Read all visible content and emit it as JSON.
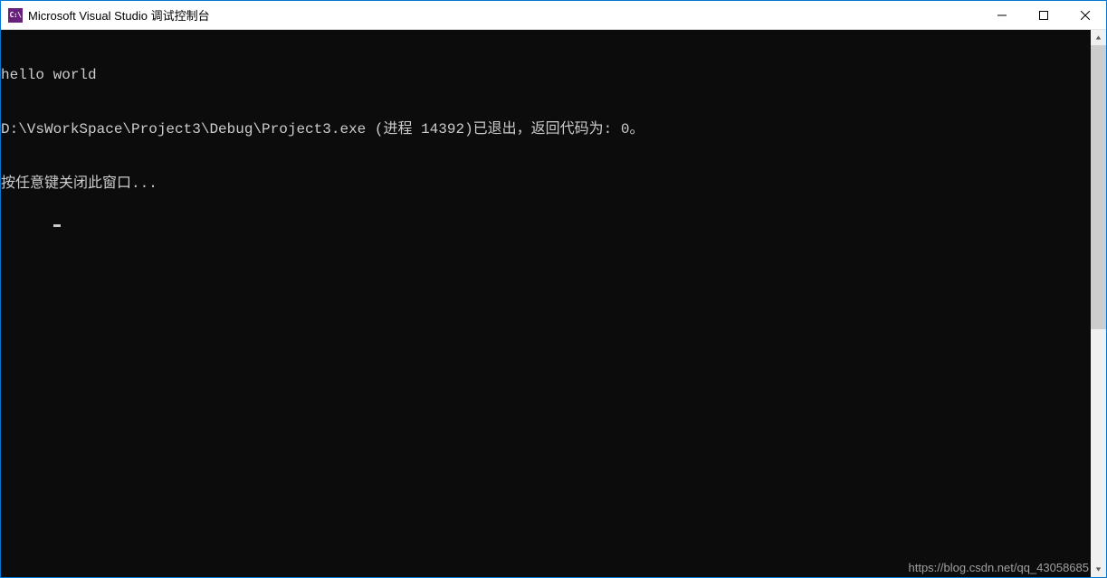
{
  "window": {
    "title": "Microsoft Visual Studio 调试控制台",
    "icon_text": "C:\\"
  },
  "console": {
    "lines": [
      "hello world",
      "D:\\VsWorkSpace\\Project3\\Debug\\Project3.exe (进程 14392)已退出，返回代码为: 0。",
      "按任意键关闭此窗口..."
    ]
  },
  "watermark": "https://blog.csdn.net/qq_43058685"
}
